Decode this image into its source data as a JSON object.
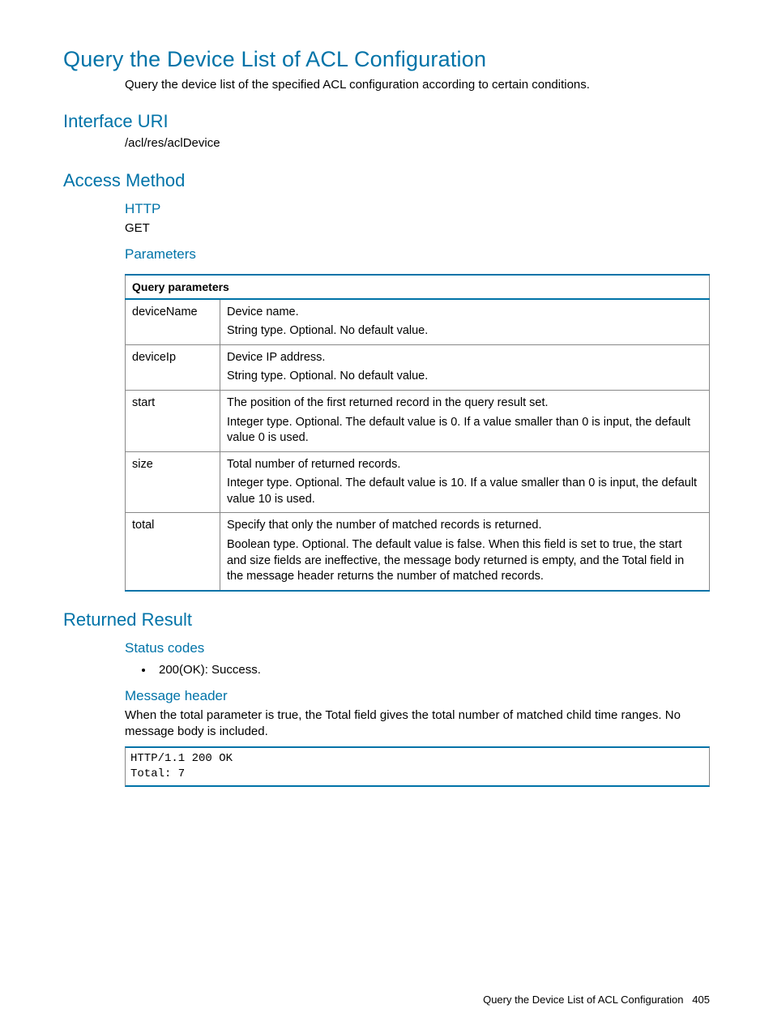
{
  "title": "Query the Device List of ACL Configuration",
  "intro": "Query the device list of the specified ACL configuration according to certain conditions.",
  "interface_uri": {
    "heading": "Interface URI",
    "value": "/acl/res/aclDevice"
  },
  "access_method": {
    "heading": "Access Method",
    "http_heading": "HTTP",
    "http_value": "GET",
    "parameters_heading": "Parameters",
    "table_header": "Query parameters",
    "rows": [
      {
        "name": "deviceName",
        "desc1": "Device name.",
        "desc2": "String type. Optional. No default value."
      },
      {
        "name": "deviceIp",
        "desc1": "Device IP address.",
        "desc2": "String type. Optional. No default value."
      },
      {
        "name": "start",
        "desc1": "The position of the first returned record in the query result set.",
        "desc2": "Integer type. Optional. The default value is 0. If a value smaller than 0 is input, the default value 0 is used."
      },
      {
        "name": "size",
        "desc1": "Total number of returned records.",
        "desc2": "Integer type. Optional. The default value is 10. If a value smaller than 0 is input, the default value 10 is used."
      },
      {
        "name": "total",
        "desc1": "Specify that only the number of matched records is returned.",
        "desc2": "Boolean type. Optional. The default value is false. When this field is set to true, the start and size fields are ineffective, the message body returned is empty, and the Total field in the message header returns the number of matched records."
      }
    ]
  },
  "returned_result": {
    "heading": "Returned Result",
    "status_codes_heading": "Status codes",
    "status_codes_item": "200(OK): Success.",
    "message_header_heading": "Message header",
    "message_header_text": "When the total parameter is true, the Total field gives the total number of matched child time ranges. No message body is included.",
    "code": "HTTP/1.1 200 OK\nTotal: 7"
  },
  "footer": {
    "text": "Query the Device List of ACL Configuration",
    "page_number": "405"
  }
}
